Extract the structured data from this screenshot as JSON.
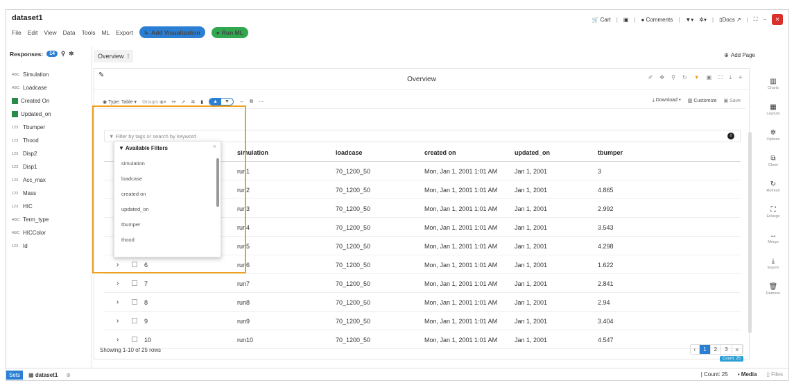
{
  "app": {
    "title": "dataset1",
    "menus": [
      "File",
      "Edit",
      "View",
      "Data",
      "Tools",
      "ML",
      "Export"
    ],
    "add_viz": "Add Visualization",
    "run_ml": "Run ML"
  },
  "right_toolbar": {
    "cart": "Cart",
    "comments": "Comments",
    "docs": "Docs"
  },
  "left": {
    "responses_label": "Responses:",
    "responses_count": "14",
    "items": [
      {
        "type": "ABC",
        "label": "Simulation"
      },
      {
        "type": "ABC",
        "label": "Loadcase"
      },
      {
        "type": "date",
        "label": "Created On"
      },
      {
        "type": "date",
        "label": "Updated_on"
      },
      {
        "type": "123",
        "label": "Tbumper"
      },
      {
        "type": "123",
        "label": "Thood"
      },
      {
        "type": "123",
        "label": "Disp2"
      },
      {
        "type": "123",
        "label": "Disp1"
      },
      {
        "type": "123",
        "label": "Acc_max"
      },
      {
        "type": "123",
        "label": "Mass"
      },
      {
        "type": "123",
        "label": "HIC"
      },
      {
        "type": "ABC",
        "label": "Term_type"
      },
      {
        "type": "ABC",
        "label": "HICColor"
      },
      {
        "type": "123",
        "label": "Id"
      }
    ]
  },
  "page": {
    "tab": "Overview",
    "tab_sep": "⁝",
    "add_page": "Add Page",
    "title": "Overview"
  },
  "toolbar": {
    "type_label": "Type: Table ▾",
    "groups_label": "Groups",
    "download": "Download ▾",
    "customize": "Customize",
    "save": "Save"
  },
  "filter": {
    "placeholder": "Filter by tags or search by keyword"
  },
  "table": {
    "columns": [
      "simulation",
      "loadcase",
      "created on",
      "updated_on",
      "tbumper"
    ],
    "rows": [
      {
        "id": "",
        "simulation": "run1",
        "loadcase": "70_1200_50",
        "created": "Mon, Jan 1, 2001 1:01 AM",
        "updated": "Jan 1, 2001",
        "tbumper": "3"
      },
      {
        "id": "",
        "simulation": "run2",
        "loadcase": "70_1200_50",
        "created": "Mon, Jan 1, 2001 1:01 AM",
        "updated": "Jan 1, 2001",
        "tbumper": "4.865"
      },
      {
        "id": "",
        "simulation": "run3",
        "loadcase": "70_1200_50",
        "created": "Mon, Jan 1, 2001 1:01 AM",
        "updated": "Jan 1, 2001",
        "tbumper": "2.992"
      },
      {
        "id": "",
        "simulation": "run4",
        "loadcase": "70_1200_50",
        "created": "Mon, Jan 1, 2001 1:01 AM",
        "updated": "Jan 1, 2001",
        "tbumper": "3.543"
      },
      {
        "id": "",
        "simulation": "run5",
        "loadcase": "70_1200_50",
        "created": "Mon, Jan 1, 2001 1:01 AM",
        "updated": "Jan 1, 2001",
        "tbumper": "4.298"
      },
      {
        "id": "6",
        "simulation": "run6",
        "loadcase": "70_1200_50",
        "created": "Mon, Jan 1, 2001 1:01 AM",
        "updated": "Jan 1, 2001",
        "tbumper": "1.622"
      },
      {
        "id": "7",
        "simulation": "run7",
        "loadcase": "70_1200_50",
        "created": "Mon, Jan 1, 2001 1:01 AM",
        "updated": "Jan 1, 2001",
        "tbumper": "2.841"
      },
      {
        "id": "8",
        "simulation": "run8",
        "loadcase": "70_1200_50",
        "created": "Mon, Jan 1, 2001 1:01 AM",
        "updated": "Jan 1, 2001",
        "tbumper": "2.94"
      },
      {
        "id": "9",
        "simulation": "run9",
        "loadcase": "70_1200_50",
        "created": "Mon, Jan 1, 2001 1:01 AM",
        "updated": "Jan 1, 2001",
        "tbumper": "3.404"
      },
      {
        "id": "10",
        "simulation": "run10",
        "loadcase": "70_1200_50",
        "created": "Mon, Jan 1, 2001 1:01 AM",
        "updated": "Jan 1, 2001",
        "tbumper": "4.547"
      }
    ],
    "showing": "Showing 1-10 of 25 rows",
    "pages": [
      "‹",
      "1",
      "2",
      "3",
      "»"
    ],
    "count_badge": "Count: 25"
  },
  "dropdown": {
    "header": "Available Filters",
    "items": [
      "simulation",
      "loadcase",
      "created on",
      "updated_on",
      "tbumper",
      "thood"
    ]
  },
  "sidebar": [
    "Charts",
    "Layouts",
    "Options",
    "Clone",
    "Refresh",
    "Enlarge",
    "Merge",
    "Export",
    "Remove"
  ],
  "status": {
    "sets": "Sets",
    "dataset": "dataset1",
    "count": "Count: 25",
    "media": "Media",
    "files": "Files"
  },
  "colors": {
    "accent": "#2a7fd4",
    "highlight": "#f0a020",
    "green": "#2fa84f",
    "close": "#d9302c"
  }
}
